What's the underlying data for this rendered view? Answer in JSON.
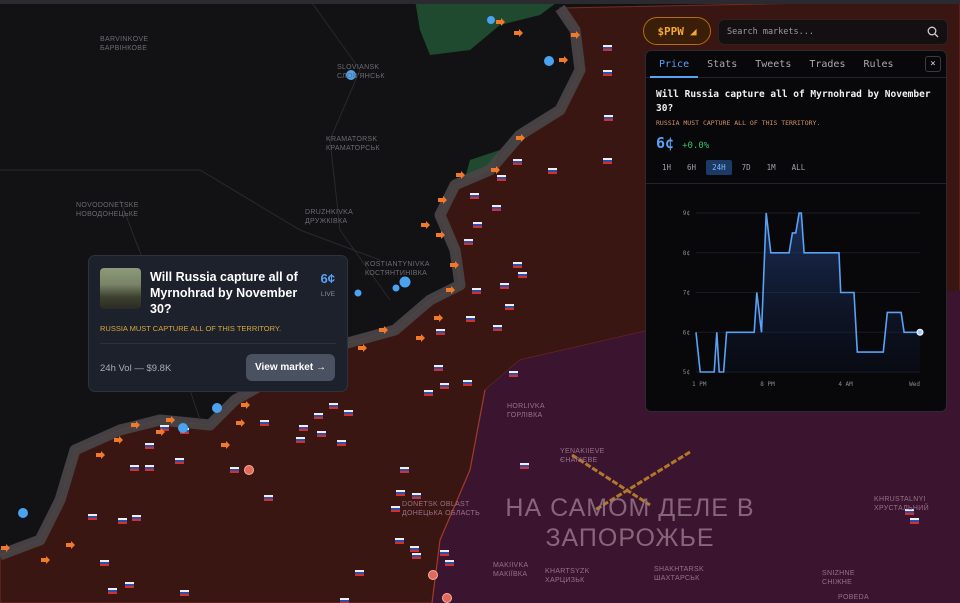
{
  "map": {
    "colors": {
      "background": "#121214",
      "occupied": "#3a1613",
      "occupied_border": "#7a2a20",
      "front_band": "#4a4648",
      "liberated": "#1f4a30",
      "contested_region": "#3b1530",
      "advance_arrow": "#f07a2a",
      "city_dot": "#4aa3f0"
    },
    "cities": [
      {
        "en": "Barvinkove",
        "local": "Барвінкове"
      },
      {
        "en": "Sloviansk",
        "local": "Слов'янськ"
      },
      {
        "en": "Kramatorsk",
        "local": "Краматорськ"
      },
      {
        "en": "Novodonetske",
        "local": "Новодонецьке"
      },
      {
        "en": "Druzhkivka",
        "local": "Дружківка"
      },
      {
        "en": "Kostiantynivka",
        "local": "Костянтинівка"
      },
      {
        "en": "Horlivka",
        "local": "Горлівка"
      },
      {
        "en": "Yenakiieve",
        "local": "Єнакієве"
      },
      {
        "en": "Donetsk Oblast",
        "local": "Донецька область"
      },
      {
        "en": "Makiivka",
        "local": "Макіївка"
      },
      {
        "en": "Khartsyzk",
        "local": "Харцизьк"
      },
      {
        "en": "Shakhtarsk",
        "local": "Шахтарськ"
      },
      {
        "en": "Khrustalnyi",
        "local": "Хрустальний"
      },
      {
        "en": "Snizhne",
        "local": "Сніжне"
      },
      {
        "en": "Pobeda",
        "local": ""
      }
    ],
    "watermark": "НА САМОМ ДЕЛЕ В ЗАПОРОЖЬЕ"
  },
  "header": {
    "token_label": "$PPW",
    "token_icon": "pizza-icon",
    "search_placeholder": "Search markets...",
    "search_value": ""
  },
  "panel": {
    "tabs": [
      {
        "label": "Price",
        "active": true
      },
      {
        "label": "Stats"
      },
      {
        "label": "Tweets"
      },
      {
        "label": "Trades"
      },
      {
        "label": "Rules"
      }
    ],
    "close_label": "×",
    "title": "Will Russia capture all of Myrnohrad by November 30?",
    "subtitle": "RUSSIA MUST CAPTURE ALL OF THIS TERRITORY.",
    "price": "6¢",
    "change": "+0.0%",
    "ranges": [
      {
        "label": "1H"
      },
      {
        "label": "6H"
      },
      {
        "label": "24H",
        "active": true
      },
      {
        "label": "7D"
      },
      {
        "label": "1M"
      },
      {
        "label": "ALL"
      }
    ],
    "accent": "#5aa2f5"
  },
  "chart_data": {
    "type": "area",
    "ylabel": "",
    "xlabel": "",
    "ylim": [
      5,
      9
    ],
    "y_ticks": [
      "5¢",
      "6¢",
      "7¢",
      "8¢",
      "9¢"
    ],
    "x_ticks": [
      {
        "label": "1 PM",
        "time": "13:00"
      },
      {
        "label": "8 PM",
        "time": "20:00"
      },
      {
        "label": "4 AM",
        "time": "04:00"
      },
      {
        "label": "Wed",
        "time": "11:40"
      }
    ],
    "grid": true,
    "points": [
      [
        "12:40",
        6
      ],
      [
        "13:06",
        5
      ],
      [
        "14:32",
        5
      ],
      [
        "14:48",
        6
      ],
      [
        "15:03",
        5
      ],
      [
        "15:30",
        5
      ],
      [
        "15:48",
        6
      ],
      [
        "18:38",
        6
      ],
      [
        "18:54",
        7
      ],
      [
        "19:23",
        6
      ],
      [
        "19:52",
        9
      ],
      [
        "20:20",
        8
      ],
      [
        "22:13",
        8
      ],
      [
        "22:33",
        8.5
      ],
      [
        "22:54",
        8.5
      ],
      [
        "23:14",
        9
      ],
      [
        "23:28",
        9
      ],
      [
        "23:45",
        8
      ],
      [
        "03:20",
        8
      ],
      [
        "03:30",
        7
      ],
      [
        "04:52",
        7
      ],
      [
        "05:12",
        5.5
      ],
      [
        "07:52",
        5.5
      ],
      [
        "08:17",
        6.5
      ],
      [
        "09:42",
        6.5
      ],
      [
        "10:00",
        6
      ],
      [
        "11:38",
        6
      ]
    ],
    "line_color": "#5aa2f5"
  },
  "card": {
    "title": "Will Russia capture all of Myrnohrad by November 30?",
    "price": "6¢",
    "live": "LIVE",
    "subtitle": "RUSSIA MUST CAPTURE ALL OF THIS TERRITORY.",
    "volume": "24h Vol — $9.8K",
    "button": "View market →"
  }
}
